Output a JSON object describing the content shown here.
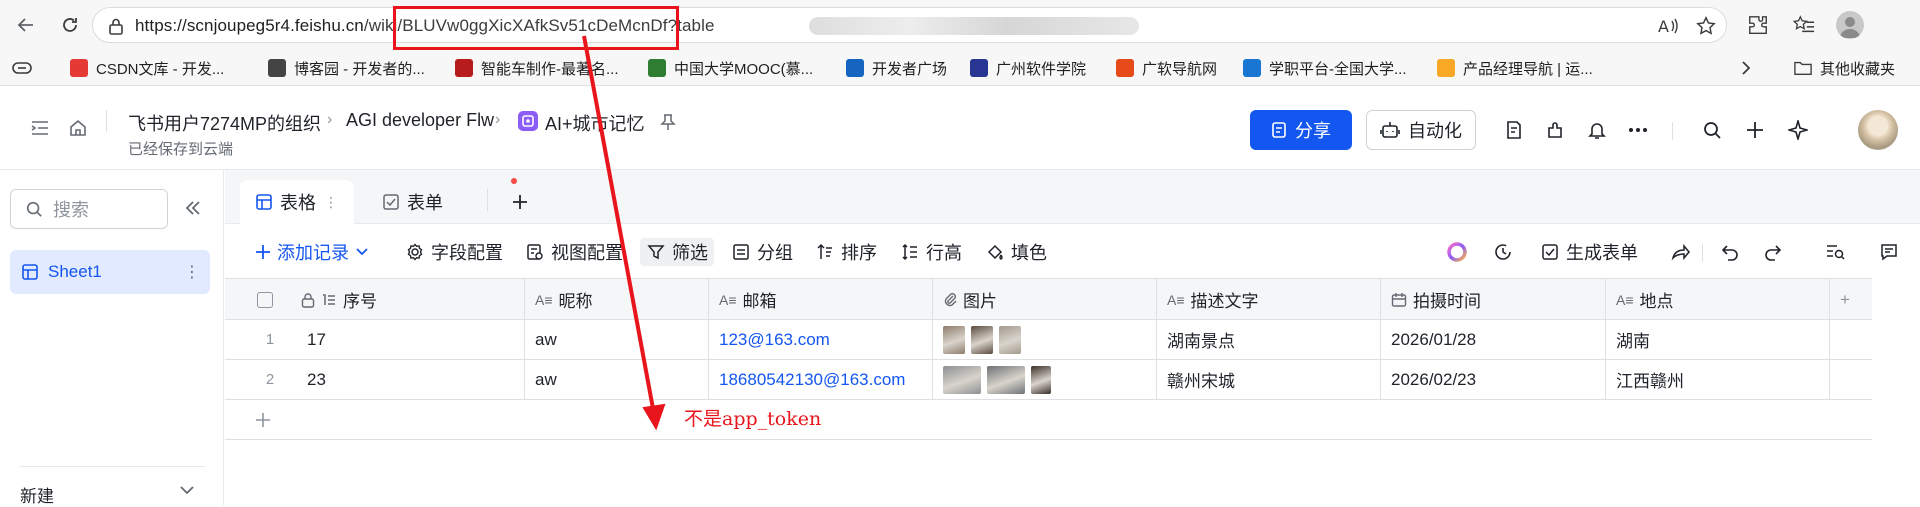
{
  "browser": {
    "url_host": "https://scnjoupeg5r4.feishu.cn",
    "url_path": "/wiki/BLUVw0ggXicXAfkSv51cDeMcnDf",
    "url_tail": "?table",
    "bookmarks": [
      {
        "label": "CSDN文库 - 开发...",
        "icon": "csdn-icon",
        "color": "#e53935"
      },
      {
        "label": "博客园 - 开发者的...",
        "icon": "cnblogs-icon",
        "color": "#444444"
      },
      {
        "label": "智能车制作-最著名...",
        "icon": "smartcar-icon",
        "color": "#b71c1c"
      },
      {
        "label": "中国大学MOOC(慕...",
        "icon": "mooc-icon",
        "color": "#2e7d32"
      },
      {
        "label": "开发者广场",
        "icon": "dev-square-icon",
        "color": "#1565c0"
      },
      {
        "label": "广州软件学院",
        "icon": "gzsoft-icon",
        "color": "#283593"
      },
      {
        "label": "广软导航网",
        "icon": "nav-icon",
        "color": "#e64a19"
      },
      {
        "label": "学职平台-全国大学...",
        "icon": "xuezhi-icon",
        "color": "#1976d2"
      },
      {
        "label": "产品经理导航 | 运...",
        "icon": "pm-icon",
        "color": "#f9a825"
      }
    ],
    "other_bookmarks": "其他收藏夹"
  },
  "header": {
    "breadcrumbs": [
      "飞书用户7274MP的组织",
      "AGI developer Flw",
      "AI+城市记忆"
    ],
    "saved_status": "已经保存到云端",
    "share_label": "分享",
    "automation_label": "自动化"
  },
  "sidebar": {
    "search_placeholder": "搜索",
    "sheet_label": "Sheet1",
    "new_label": "新建"
  },
  "tabs": [
    {
      "label": "表格"
    },
    {
      "label": "表单"
    }
  ],
  "toolbar": {
    "add_record": "添加记录",
    "field_config": "字段配置",
    "view_config": "视图配置",
    "filter": "筛选",
    "group": "分组",
    "sort": "排序",
    "row_height": "行高",
    "fill": "填色",
    "generate_form": "生成表单"
  },
  "table": {
    "columns": [
      "序号",
      "昵称",
      "邮箱",
      "图片",
      "描述文字",
      "拍摄时间",
      "地点"
    ],
    "rows": [
      {
        "num": "1",
        "seq": "17",
        "nickname": "aw",
        "email": "123@163.com",
        "description": "湖南景点",
        "time": "2026/01/28",
        "place": "湖南",
        "thumbs": [
          "#8d7b6a",
          "#5b4a3e",
          "#a39a8e"
        ]
      },
      {
        "num": "2",
        "seq": "23",
        "nickname": "aw",
        "email": "18680542130@163.com",
        "description": "赣州宋城",
        "time": "2026/02/23",
        "place": "江西赣州",
        "thumbs": [
          "#8c8f92",
          "#6d7276",
          "#3a3028"
        ]
      }
    ]
  },
  "annotation": {
    "note": "不是app_token",
    "color": "#e8161c"
  }
}
